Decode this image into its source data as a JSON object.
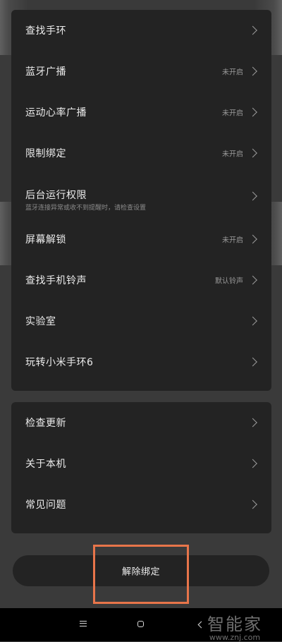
{
  "main_settings": {
    "items": [
      {
        "label": "查找手环",
        "value": ""
      },
      {
        "label": "蓝牙广播",
        "value": "未开启"
      },
      {
        "label": "运动心率广播",
        "value": "未开启"
      },
      {
        "label": "限制绑定",
        "value": "未开启"
      },
      {
        "label": "后台运行权限",
        "sublabel": "蓝牙连接异常或收不到提醒时，请检查设置",
        "value": ""
      },
      {
        "label": "屏幕解锁",
        "value": "未开启"
      },
      {
        "label": "查找手机铃声",
        "value": "默认铃声"
      },
      {
        "label": "实验室",
        "value": ""
      },
      {
        "label": "玩转小米手环6",
        "value": ""
      }
    ]
  },
  "info_settings": {
    "items": [
      {
        "label": "检查更新"
      },
      {
        "label": "关于本机"
      },
      {
        "label": "常见问题"
      }
    ]
  },
  "unbind_button": {
    "label": "解除绑定"
  },
  "highlight_color": "#e8754a",
  "nav_bar": {
    "menu_icon": "menu-icon",
    "home_icon": "home-icon",
    "back_icon": "back-icon"
  },
  "watermark": {
    "text": "智能家",
    "url": "www.znj.com"
  }
}
